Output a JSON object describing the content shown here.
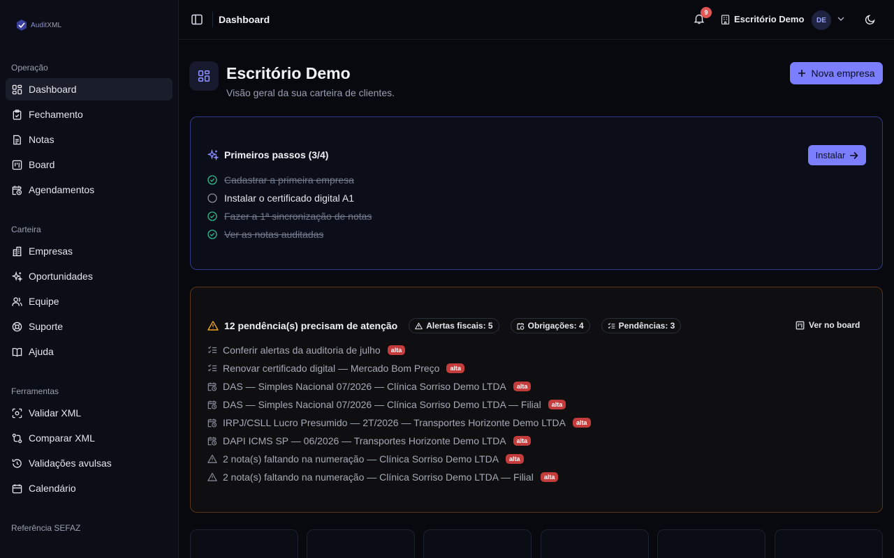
{
  "brand": {
    "name_a": "Audit",
    "name_b": "XML",
    "accent": "#7b7fff"
  },
  "sidebar": {
    "sections": [
      {
        "label": "Operação",
        "items": [
          {
            "label": "Dashboard",
            "icon": "grid-icon",
            "active": true
          },
          {
            "label": "Fechamento",
            "icon": "clipboard-check-icon"
          },
          {
            "label": "Notas",
            "icon": "file-text-icon"
          },
          {
            "label": "Board",
            "icon": "kanban-icon"
          },
          {
            "label": "Agendamentos",
            "icon": "calendar-clock-icon"
          }
        ]
      },
      {
        "label": "Carteira",
        "items": [
          {
            "label": "Empresas",
            "icon": "building-icon"
          },
          {
            "label": "Oportunidades",
            "icon": "sparkles-icon"
          },
          {
            "label": "Equipe",
            "icon": "users-icon"
          },
          {
            "label": "Suporte",
            "icon": "lifebuoy-icon"
          },
          {
            "label": "Ajuda",
            "icon": "book-icon"
          }
        ]
      },
      {
        "label": "Ferramentas",
        "items": [
          {
            "label": "Validar XML",
            "icon": "scan-icon"
          },
          {
            "label": "Comparar XML",
            "icon": "git-compare-icon"
          },
          {
            "label": "Validações avulsas",
            "icon": "history-icon"
          },
          {
            "label": "Calendário",
            "icon": "calendar-icon"
          }
        ]
      },
      {
        "label": "Referência SEFAZ",
        "items": []
      }
    ]
  },
  "topbar": {
    "title": "Dashboard",
    "notifications": "9",
    "org_name": "Escritório Demo",
    "avatar_initials": "DE"
  },
  "header": {
    "title": "Escritório Demo",
    "subtitle": "Visão geral da sua carteira de clientes.",
    "new_company_label": "Nova empresa"
  },
  "onboarding": {
    "title": "Primeiros passos (3/4)",
    "install_label": "Instalar",
    "steps": [
      {
        "label": "Cadastrar a primeira empresa",
        "done": true
      },
      {
        "label": "Instalar o certificado digital A1",
        "done": false
      },
      {
        "label": "Fazer a 1ª sincronização de notas",
        "done": true
      },
      {
        "label": "Ver as notas auditadas",
        "done": true
      }
    ]
  },
  "pending": {
    "title": "12 pendência(s) precisam de atenção",
    "chips": [
      {
        "label": "Alertas fiscais: 5",
        "icon": "alert-triangle-icon"
      },
      {
        "label": "Obrigações: 4",
        "icon": "calendar-clock-icon"
      },
      {
        "label": "Pendências: 3",
        "icon": "list-checks-icon"
      }
    ],
    "board_link": "Ver no board",
    "priority_label": "alta",
    "items": [
      {
        "text": "Conferir alertas da auditoria de julho",
        "icon": "list-checks-icon"
      },
      {
        "text": "Renovar certificado digital — Mercado Bom Preço",
        "icon": "list-checks-icon"
      },
      {
        "text": "DAS — Simples Nacional 07/2026 — Clínica Sorriso Demo LTDA",
        "icon": "calendar-clock-icon"
      },
      {
        "text": "DAS — Simples Nacional 07/2026 — Clínica Sorriso Demo LTDA — Filial",
        "icon": "calendar-clock-icon"
      },
      {
        "text": "IRPJ/CSLL Lucro Presumido — 2T/2026 — Transportes Horizonte Demo LTDA",
        "icon": "calendar-clock-icon"
      },
      {
        "text": "DAPI ICMS SP — 06/2026 — Transportes Horizonte Demo LTDA",
        "icon": "calendar-clock-icon"
      },
      {
        "text": "2 nota(s) faltando na numeração — Clínica Sorriso Demo LTDA",
        "icon": "alert-triangle-icon"
      },
      {
        "text": "2 nota(s) faltando na numeração — Clínica Sorriso Demo LTDA — Filial",
        "icon": "alert-triangle-icon"
      }
    ]
  }
}
